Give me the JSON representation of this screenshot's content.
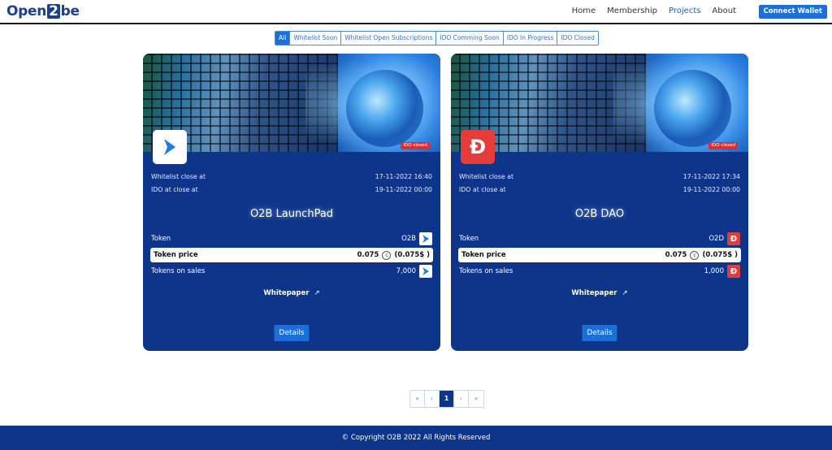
{
  "header": {
    "logo_left": "Open",
    "logo_mid": "2",
    "logo_right": "be",
    "nav": [
      "Home",
      "Membership",
      "Projects",
      "About"
    ],
    "active_nav": "Projects",
    "connect_label": "Connect Wallet"
  },
  "filters": [
    "All",
    "Whitelist Soon",
    "Whitelist Open Subscriptions",
    "IDO Comming Soon",
    "IDO In Progress",
    "IDO Closed"
  ],
  "projects": [
    {
      "name": "O2B LaunchPad",
      "status_badge": "IDO closed",
      "icon": "play-arrow-icon",
      "whitelist_close_label": "Whitelist close at",
      "whitelist_close_value": "17-11-2022 16:40",
      "ido_close_label": "IDO at close at",
      "ido_close_value": "19-11-2022 00:00",
      "token_label": "Token",
      "token_value": "O2B",
      "price_label": "Token price",
      "price_value": "0.075",
      "price_usd": "(0.075$ )",
      "sales_label": "Tokens on sales",
      "sales_value": "7,000",
      "whitepaper_label": "Whitepaper",
      "details_label": "Details"
    },
    {
      "name": "O2B DAO",
      "status_badge": "IDO closed",
      "icon": "dao-d-icon",
      "whitelist_close_label": "Whitelist close at",
      "whitelist_close_value": "17-11-2022 17:34",
      "ido_close_label": "IDO at close at",
      "ido_close_value": "19-11-2022 00:00",
      "token_label": "Token",
      "token_value": "O2D",
      "price_label": "Token price",
      "price_value": "0.075",
      "price_usd": "(0.075$ )",
      "sales_label": "Tokens on sales",
      "sales_value": "1,000",
      "whitepaper_label": "Whitepaper",
      "details_label": "Details"
    }
  ],
  "pagination": {
    "first": "«",
    "prev": "‹",
    "current": "1",
    "next": "›",
    "last": "»"
  },
  "footer": {
    "text": "© Copyright O2B 2022 All Rights Reserved"
  },
  "colors": {
    "brand": "#0d358a",
    "accent": "#1d6fd8",
    "badge": "#d63030"
  }
}
